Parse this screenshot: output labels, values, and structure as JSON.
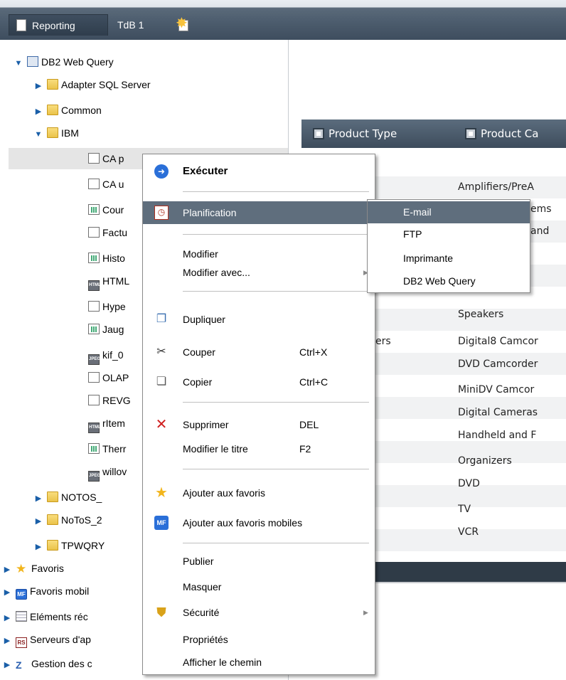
{
  "tabs": {
    "reporting": "Reporting",
    "tdb": "TdB 1"
  },
  "tree": {
    "root": "DB2 Web Query",
    "adapter": "Adapter SQL Server",
    "common": "Common",
    "ibm": "IBM",
    "items": [
      "CA p",
      "CA u",
      "Cour",
      "Factu",
      "Histo",
      "HTML",
      "Hype",
      "Jaug",
      "kif_0",
      "OLAP",
      "REVG",
      "rItem",
      "Therr",
      "willov"
    ],
    "notos1": "NOTOS_",
    "notos2": "NoToS_2",
    "tpwqry": "TPWQRY",
    "favoris": "Favoris",
    "favoris_mobiles": "Favoris mobil",
    "elements": "Eléments réc",
    "serveurs": "Serveurs d'ap",
    "gestion": "Gestion des c"
  },
  "grid": {
    "col1": "Product Type",
    "col2": "Product Ca",
    "col1_cells": [
      "",
      "",
      "",
      "",
      "",
      "ers",
      "",
      "",
      "",
      "",
      "",
      "",
      "",
      ""
    ],
    "col2_cells": [
      "Amplifiers/PreA",
      "ems",
      "and",
      "",
      "",
      "Speakers",
      "Digital8 Camcor",
      "DVD Camcorder",
      "MiniDV Camcor",
      "Digital Cameras",
      "Handheld and F",
      "Organizers",
      "DVD",
      "TV",
      "VCR"
    ]
  },
  "menu": {
    "executer": "Exécuter",
    "planification": "Planification",
    "modifier": "Modifier",
    "modifier_avec": "Modifier avec...",
    "dupliquer": "Dupliquer",
    "couper": "Couper",
    "couper_sc": "Ctrl+X",
    "copier": "Copier",
    "copier_sc": "Ctrl+C",
    "supprimer": "Supprimer",
    "supprimer_sc": "DEL",
    "modifier_titre": "Modifier le titre",
    "modifier_titre_sc": "F2",
    "ajouter_favoris": "Ajouter aux favoris",
    "ajouter_favoris_mobiles": "Ajouter aux favoris mobiles",
    "publier": "Publier",
    "masquer": "Masquer",
    "securite": "Sécurité",
    "proprietes": "Propriétés",
    "afficher_chemin": "Afficher le chemin"
  },
  "submenu": {
    "email": "E-mail",
    "ftp": "FTP",
    "imprimante": "Imprimante",
    "db2": "DB2 Web Query"
  },
  "colors": {
    "menu_highlight": "#5f6e7d",
    "header_bar": "#3d4c5c"
  }
}
